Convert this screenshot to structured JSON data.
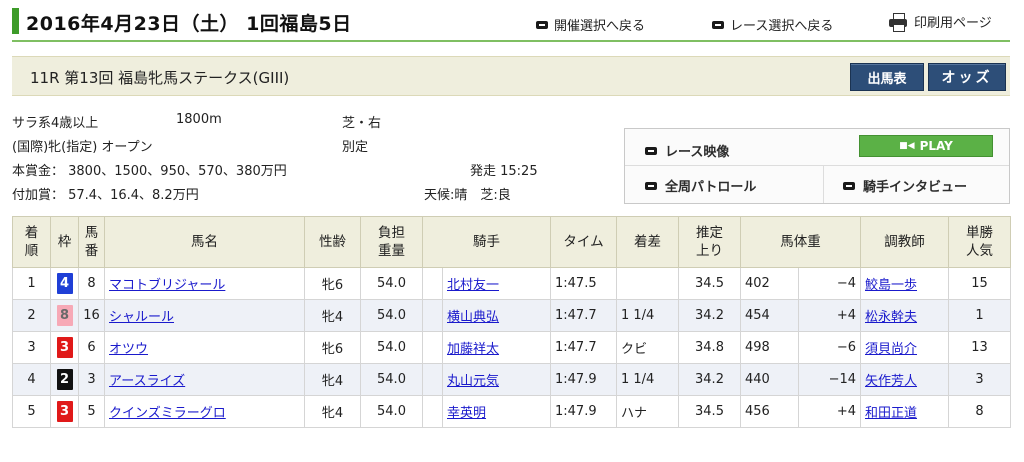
{
  "header": {
    "title": "2016年4月23日（土） 1回福島5日",
    "back_meeting": "開催選択へ戻る",
    "back_race": "レース選択へ戻る",
    "print": "印刷用ページ"
  },
  "race": {
    "name": "11R 第13回 福島牝馬ステークス(GIII)",
    "btn_card": "出馬表",
    "btn_odds": "オッズ"
  },
  "info": {
    "class": "サラ系4歳以上",
    "distance": "1800m",
    "surface": "芝・右",
    "condition": "(国際)牝(指定) オープン",
    "weight_rule": "別定",
    "prize": "本賞金： 3800、1500、950、570、380万円",
    "start": "発走 15:25",
    "extra_prize": "付加賞： 57.4、16.4、8.2万円",
    "weather": "天候:晴　芝:良"
  },
  "video": {
    "race_video": "レース映像",
    "play": "PLAY",
    "patrol": "全周パトロール",
    "interview": "騎手インタビュー"
  },
  "table": {
    "headers": {
      "rank": "着\n順",
      "waku": "枠",
      "number": "馬\n番",
      "horse": "馬名",
      "sexage": "性齢",
      "weight": "負担\n重量",
      "jockey": "騎手",
      "time": "タイム",
      "margin": "着差",
      "last3f": "推定\n上り",
      "bodyweight": "馬体重",
      "trainer": "調教師",
      "pop": "単勝\n人気"
    },
    "rows": [
      {
        "rank": "1",
        "waku": "4",
        "waku_bg": "#1f3fd6",
        "waku_fg": "#ffffff",
        "num": "8",
        "horse": "マコトブリジャール",
        "sexage": "牝6",
        "weight": "54.0",
        "jockey": "北村友一",
        "time": "1:47.5",
        "margin": "",
        "last3f": "34.5",
        "bw": "402",
        "bwdiff": "−4",
        "trainer": "鮫島一歩",
        "pop": "15"
      },
      {
        "rank": "2",
        "waku": "8",
        "waku_bg": "#f7a9b6",
        "waku_fg": "#6a6a6a",
        "num": "16",
        "horse": "シャルール",
        "sexage": "牝4",
        "weight": "54.0",
        "jockey": "横山典弘",
        "time": "1:47.7",
        "margin": "1 1/4",
        "last3f": "34.2",
        "bw": "454",
        "bwdiff": "+4",
        "trainer": "松永幹夫",
        "pop": "1"
      },
      {
        "rank": "3",
        "waku": "3",
        "waku_bg": "#e01919",
        "waku_fg": "#ffffff",
        "num": "6",
        "horse": "オツウ",
        "sexage": "牝6",
        "weight": "54.0",
        "jockey": "加藤祥太",
        "time": "1:47.7",
        "margin": "クビ",
        "last3f": "34.8",
        "bw": "498",
        "bwdiff": "−6",
        "trainer": "須貝尚介",
        "pop": "13"
      },
      {
        "rank": "4",
        "waku": "2",
        "waku_bg": "#111111",
        "waku_fg": "#ffffff",
        "num": "3",
        "horse": "アースライズ",
        "sexage": "牝4",
        "weight": "54.0",
        "jockey": "丸山元気",
        "time": "1:47.9",
        "margin": "1 1/4",
        "last3f": "34.2",
        "bw": "440",
        "bwdiff": "−14",
        "trainer": "矢作芳人",
        "pop": "3"
      },
      {
        "rank": "5",
        "waku": "3",
        "waku_bg": "#e01919",
        "waku_fg": "#ffffff",
        "num": "5",
        "horse": "クインズミラーグロ",
        "sexage": "牝4",
        "weight": "54.0",
        "jockey": "幸英明",
        "time": "1:47.9",
        "margin": "ハナ",
        "last3f": "34.5",
        "bw": "456",
        "bwdiff": "+4",
        "trainer": "和田正道",
        "pop": "8"
      }
    ]
  },
  "colors": {
    "accent_green": "#3d9b29",
    "header_bg": "#efeedd",
    "button_navy": "#2d4e78",
    "play_green": "#5bb146",
    "link_blue": "#1a1acc"
  }
}
